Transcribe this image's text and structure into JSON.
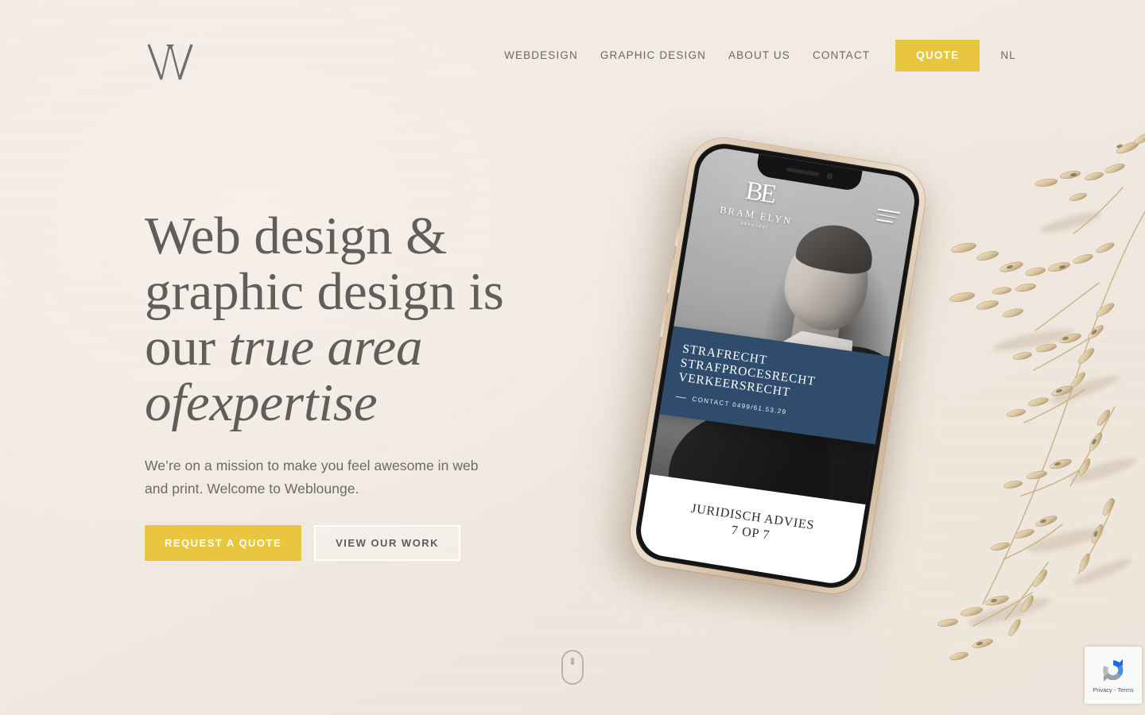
{
  "brand": {
    "logo_alt": "Weblounge W monogram"
  },
  "nav": {
    "items": [
      {
        "label": "WEBDESIGN",
        "name": "nav-link-webdesign"
      },
      {
        "label": "GRAPHIC DESIGN",
        "name": "nav-link-graphic-design"
      },
      {
        "label": "ABOUT US",
        "name": "nav-link-about-us"
      },
      {
        "label": "CONTACT",
        "name": "nav-link-contact"
      }
    ],
    "quote_label": "QUOTE",
    "language_label": "NL"
  },
  "hero": {
    "title_line1": "Web design &",
    "title_line2": "graphic design is",
    "title_line3_plain": "our ",
    "title_line3_em": "true area",
    "title_line4_em": "ofexpertise",
    "subtitle": "We’re on a mission to make you feel awesome in web and print. Welcome to Weblounge.",
    "primary_button": "REQUEST A QUOTE",
    "secondary_button": "VIEW OUR WORK"
  },
  "mockup": {
    "device": "smartphone-gold",
    "screen": {
      "monogram": "BE",
      "brand_name": "BRAM ELYN",
      "brand_role": "advocaat",
      "menu_icon": "hamburger-icon",
      "banner_line1": "STRAFRECHT",
      "banner_line2": "STRAFPROCESRECHT",
      "banner_line3": "VERKEERSRECHT",
      "banner_contact": "CONTACT 0499/61.53.29",
      "footer_line1": "JURIDISCH ADVIES",
      "footer_line2": "7 OP 7"
    }
  },
  "decor": {
    "grass_alt": "dried grass stems",
    "scroll_icon": "mouse-scroll-icon"
  },
  "recaptcha": {
    "legal": "Privacy - Terms"
  },
  "colors": {
    "background": "#f2ebe3",
    "accent_yellow": "#e9c63f",
    "heading_gray": "#5f5e58",
    "body_gray": "#6c6a64",
    "banner_navy": "#2b4663"
  }
}
